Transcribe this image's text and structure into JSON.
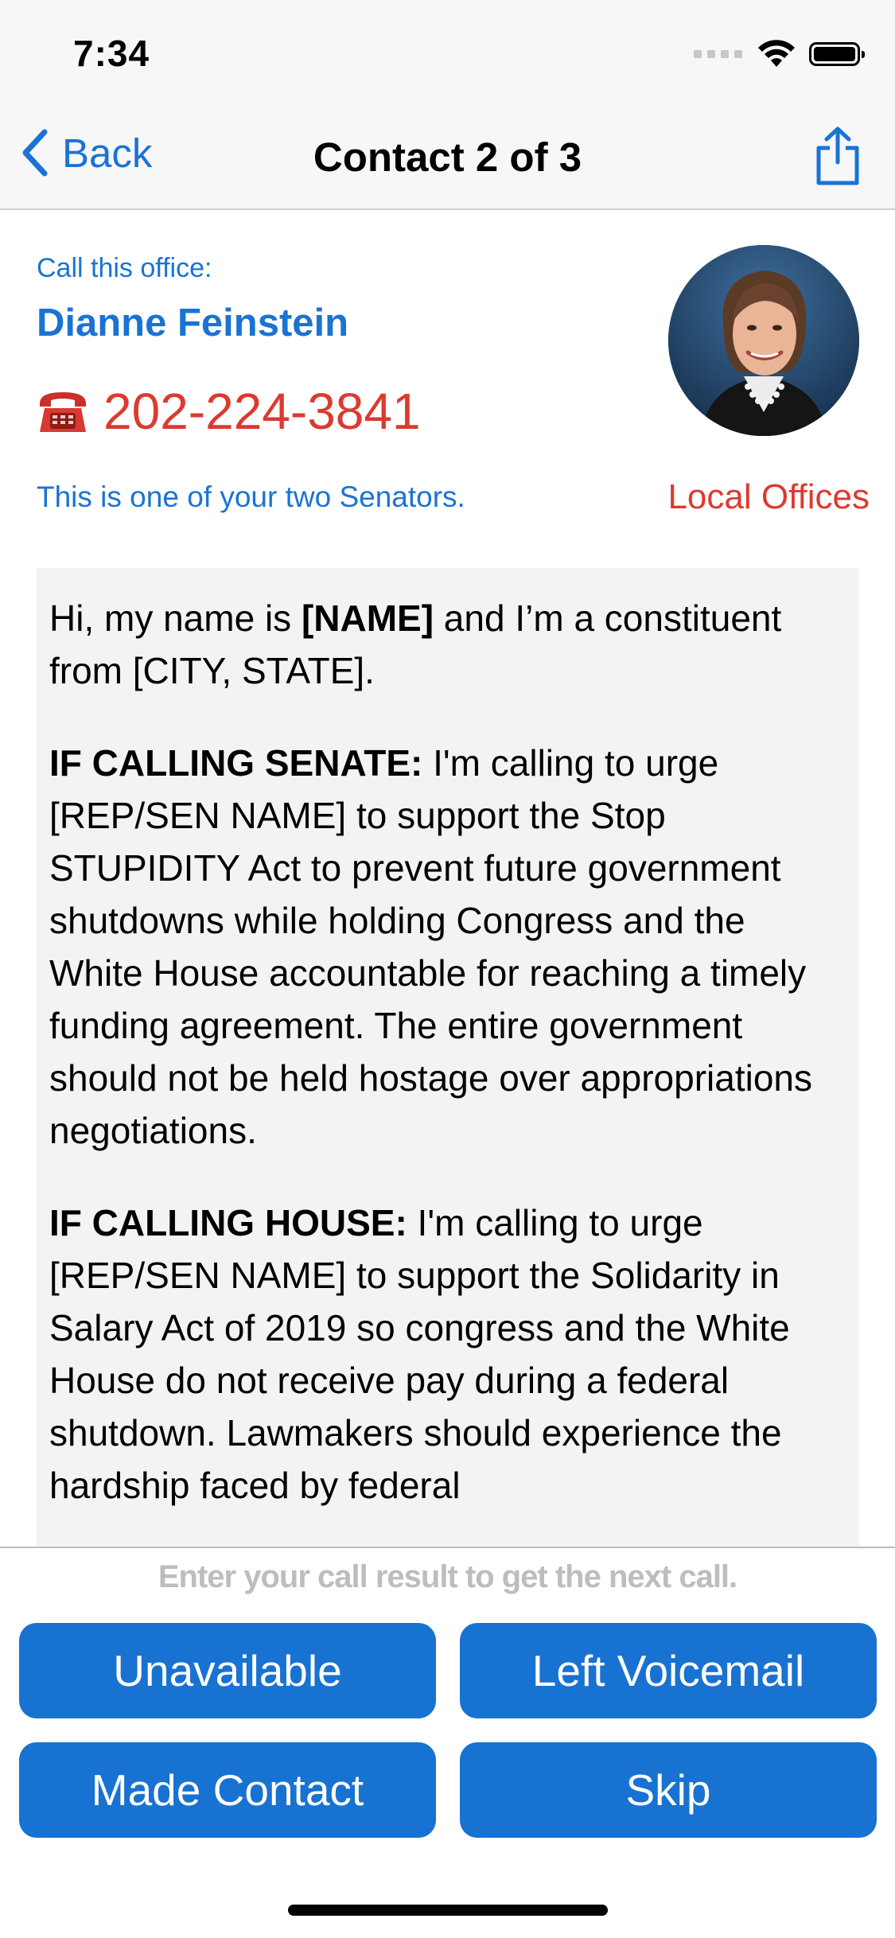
{
  "status_bar": {
    "time": "7:34"
  },
  "nav": {
    "back_label": "Back",
    "title": "Contact 2 of 3"
  },
  "contact": {
    "call_label": "Call this office:",
    "name": "Dianne Feinstein",
    "phone": "202-224-3841",
    "note": "This is one of your two Senators.",
    "local_offices": "Local Offices"
  },
  "script": {
    "intro_pre": "Hi, my name is ",
    "intro_bold": "[NAME]",
    "intro_post": " and I’m a constituent from [CITY, STATE].",
    "senate_heading": "IF CALLING SENATE:",
    "senate_text": " I'm calling to urge [REP/SEN NAME] to support the Stop STUPIDITY Act to prevent future government shutdowns while holding Congress and the White House accountable for reaching a timely funding agreement. The entire government should not be held hostage over appropriations negotiations.",
    "house_heading": "IF CALLING HOUSE:",
    "house_text": " I'm calling to urge [REP/SEN NAME] to support the Solidarity in Salary Act of 2019 so congress and the White House do not receive pay during a federal shutdown. Lawmakers should experience the hardship faced by federal"
  },
  "results": {
    "hint": "Enter your call result to get the next call.",
    "unavailable": "Unavailable",
    "left_voicemail": "Left Voicemail",
    "made_contact": "Made Contact",
    "skip": "Skip"
  },
  "colors": {
    "accent_blue": "#1a73d4",
    "button_blue": "#1872d2",
    "phone_red": "#dc3a2f"
  },
  "icons": [
    "signal-icon",
    "wifi-icon",
    "battery-icon",
    "back-chevron-icon",
    "share-icon",
    "telephone-icon",
    "avatar-photo"
  ]
}
